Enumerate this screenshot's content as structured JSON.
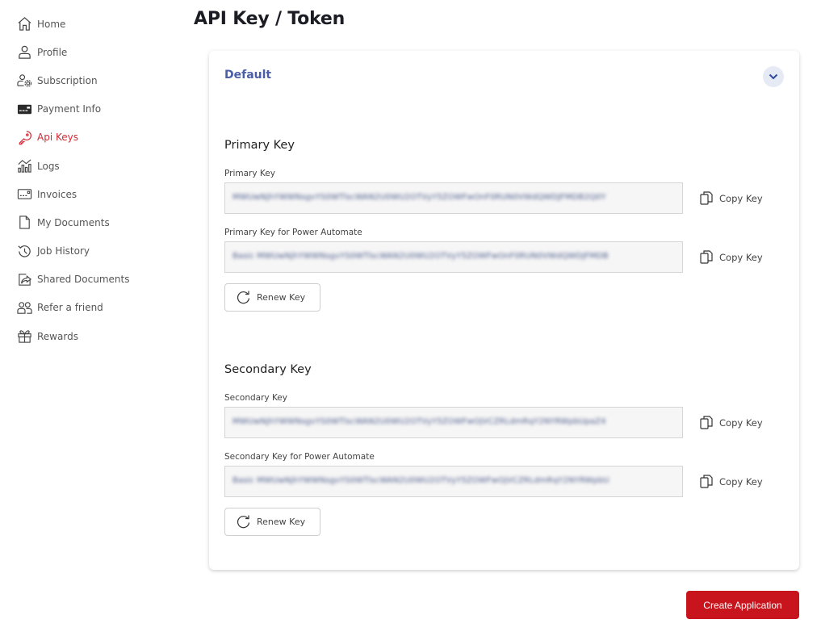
{
  "sidebar": {
    "items": [
      {
        "label": "Home",
        "icon": "home-icon",
        "active": false
      },
      {
        "label": "Profile",
        "icon": "user-icon",
        "active": false
      },
      {
        "label": "Subscription",
        "icon": "user-gear-icon",
        "active": false
      },
      {
        "label": "Payment Info",
        "icon": "credit-card-icon",
        "active": false
      },
      {
        "label": "Api Keys",
        "icon": "key-icon",
        "active": true
      },
      {
        "label": "Logs",
        "icon": "chart-logs-icon",
        "active": false
      },
      {
        "label": "Invoices",
        "icon": "invoice-icon",
        "active": false
      },
      {
        "label": "My Documents",
        "icon": "document-icon",
        "active": false
      },
      {
        "label": "Job History",
        "icon": "history-icon",
        "active": false
      },
      {
        "label": "Shared Documents",
        "icon": "share-icon",
        "active": false
      },
      {
        "label": "Refer a friend",
        "icon": "users-icon",
        "active": false
      },
      {
        "label": "Rewards",
        "icon": "gift-icon",
        "active": false
      }
    ]
  },
  "page": {
    "title": "API Key / Token"
  },
  "card": {
    "header": "Default",
    "primary": {
      "section_title": "Primary Key",
      "key_label": "Primary Key",
      "key_value": "MWUwNjhYWWNsgvYS0WTlscWAN2U0WU2OTVyY5ZOWFwOnF0RUN0VWdQWDJFMDB2Q0Y",
      "pa_label": "Primary Key for Power Automate",
      "pa_value": "Basic MWUwNjhYWWNsgvYS0WTlscWAN2U0WU2OTVyY5ZOWFwOnF0RUN0VWdQWDJFMDB",
      "copy_label": "Copy Key",
      "renew_label": "Renew Key"
    },
    "secondary": {
      "section_title": "Secondary Key",
      "key_label": "Secondary Key",
      "key_value": "MWUwNjhYWWNsgvYS0WTlscWAN2U0WU2OTVyY5ZOWFwOjVCZRLdmRqY2NYRWpbUpaZ4",
      "pa_label": "Secondary Key for Power Automate",
      "pa_value": "Basic MWUwNjhYWWNsgvYS0WTlscWAN2U0WU2OTVyY5ZOWFwOjVCZRLdmRqY2NYRWpbU",
      "copy_label": "Copy Key",
      "renew_label": "Renew Key"
    }
  },
  "actions": {
    "create_label": "Create Application"
  },
  "colors": {
    "accent_red": "#c8141c",
    "active_nav": "#d22b36",
    "header_blue": "#4a5ea8"
  }
}
